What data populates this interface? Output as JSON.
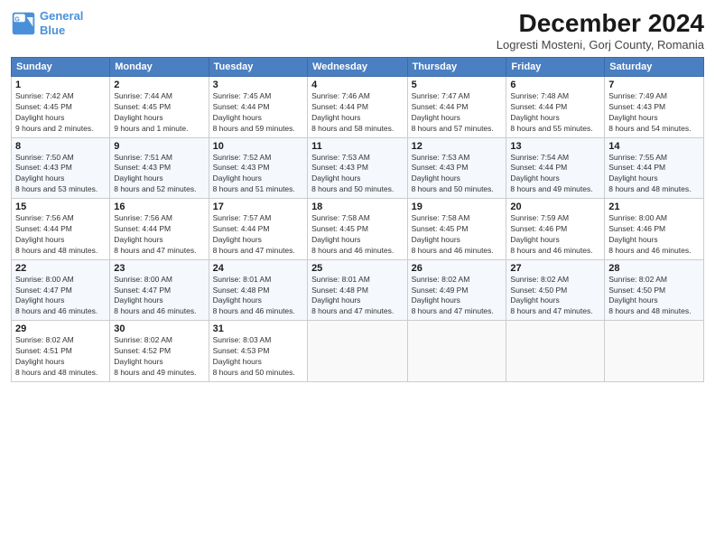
{
  "header": {
    "logo_line1": "General",
    "logo_line2": "Blue",
    "title": "December 2024",
    "subtitle": "Logresti Mosteni, Gorj County, Romania"
  },
  "calendar": {
    "days_of_week": [
      "Sunday",
      "Monday",
      "Tuesday",
      "Wednesday",
      "Thursday",
      "Friday",
      "Saturday"
    ],
    "weeks": [
      [
        {
          "day": "1",
          "sunrise": "7:42 AM",
          "sunset": "4:45 PM",
          "daylight": "9 hours and 2 minutes."
        },
        {
          "day": "2",
          "sunrise": "7:44 AM",
          "sunset": "4:45 PM",
          "daylight": "9 hours and 1 minute."
        },
        {
          "day": "3",
          "sunrise": "7:45 AM",
          "sunset": "4:44 PM",
          "daylight": "8 hours and 59 minutes."
        },
        {
          "day": "4",
          "sunrise": "7:46 AM",
          "sunset": "4:44 PM",
          "daylight": "8 hours and 58 minutes."
        },
        {
          "day": "5",
          "sunrise": "7:47 AM",
          "sunset": "4:44 PM",
          "daylight": "8 hours and 57 minutes."
        },
        {
          "day": "6",
          "sunrise": "7:48 AM",
          "sunset": "4:44 PM",
          "daylight": "8 hours and 55 minutes."
        },
        {
          "day": "7",
          "sunrise": "7:49 AM",
          "sunset": "4:43 PM",
          "daylight": "8 hours and 54 minutes."
        }
      ],
      [
        {
          "day": "8",
          "sunrise": "7:50 AM",
          "sunset": "4:43 PM",
          "daylight": "8 hours and 53 minutes."
        },
        {
          "day": "9",
          "sunrise": "7:51 AM",
          "sunset": "4:43 PM",
          "daylight": "8 hours and 52 minutes."
        },
        {
          "day": "10",
          "sunrise": "7:52 AM",
          "sunset": "4:43 PM",
          "daylight": "8 hours and 51 minutes."
        },
        {
          "day": "11",
          "sunrise": "7:53 AM",
          "sunset": "4:43 PM",
          "daylight": "8 hours and 50 minutes."
        },
        {
          "day": "12",
          "sunrise": "7:53 AM",
          "sunset": "4:43 PM",
          "daylight": "8 hours and 50 minutes."
        },
        {
          "day": "13",
          "sunrise": "7:54 AM",
          "sunset": "4:44 PM",
          "daylight": "8 hours and 49 minutes."
        },
        {
          "day": "14",
          "sunrise": "7:55 AM",
          "sunset": "4:44 PM",
          "daylight": "8 hours and 48 minutes."
        }
      ],
      [
        {
          "day": "15",
          "sunrise": "7:56 AM",
          "sunset": "4:44 PM",
          "daylight": "8 hours and 48 minutes."
        },
        {
          "day": "16",
          "sunrise": "7:56 AM",
          "sunset": "4:44 PM",
          "daylight": "8 hours and 47 minutes."
        },
        {
          "day": "17",
          "sunrise": "7:57 AM",
          "sunset": "4:44 PM",
          "daylight": "8 hours and 47 minutes."
        },
        {
          "day": "18",
          "sunrise": "7:58 AM",
          "sunset": "4:45 PM",
          "daylight": "8 hours and 46 minutes."
        },
        {
          "day": "19",
          "sunrise": "7:58 AM",
          "sunset": "4:45 PM",
          "daylight": "8 hours and 46 minutes."
        },
        {
          "day": "20",
          "sunrise": "7:59 AM",
          "sunset": "4:46 PM",
          "daylight": "8 hours and 46 minutes."
        },
        {
          "day": "21",
          "sunrise": "8:00 AM",
          "sunset": "4:46 PM",
          "daylight": "8 hours and 46 minutes."
        }
      ],
      [
        {
          "day": "22",
          "sunrise": "8:00 AM",
          "sunset": "4:47 PM",
          "daylight": "8 hours and 46 minutes."
        },
        {
          "day": "23",
          "sunrise": "8:00 AM",
          "sunset": "4:47 PM",
          "daylight": "8 hours and 46 minutes."
        },
        {
          "day": "24",
          "sunrise": "8:01 AM",
          "sunset": "4:48 PM",
          "daylight": "8 hours and 46 minutes."
        },
        {
          "day": "25",
          "sunrise": "8:01 AM",
          "sunset": "4:48 PM",
          "daylight": "8 hours and 47 minutes."
        },
        {
          "day": "26",
          "sunrise": "8:02 AM",
          "sunset": "4:49 PM",
          "daylight": "8 hours and 47 minutes."
        },
        {
          "day": "27",
          "sunrise": "8:02 AM",
          "sunset": "4:50 PM",
          "daylight": "8 hours and 47 minutes."
        },
        {
          "day": "28",
          "sunrise": "8:02 AM",
          "sunset": "4:50 PM",
          "daylight": "8 hours and 48 minutes."
        }
      ],
      [
        {
          "day": "29",
          "sunrise": "8:02 AM",
          "sunset": "4:51 PM",
          "daylight": "8 hours and 48 minutes."
        },
        {
          "day": "30",
          "sunrise": "8:02 AM",
          "sunset": "4:52 PM",
          "daylight": "8 hours and 49 minutes."
        },
        {
          "day": "31",
          "sunrise": "8:03 AM",
          "sunset": "4:53 PM",
          "daylight": "8 hours and 50 minutes."
        },
        null,
        null,
        null,
        null
      ]
    ]
  }
}
